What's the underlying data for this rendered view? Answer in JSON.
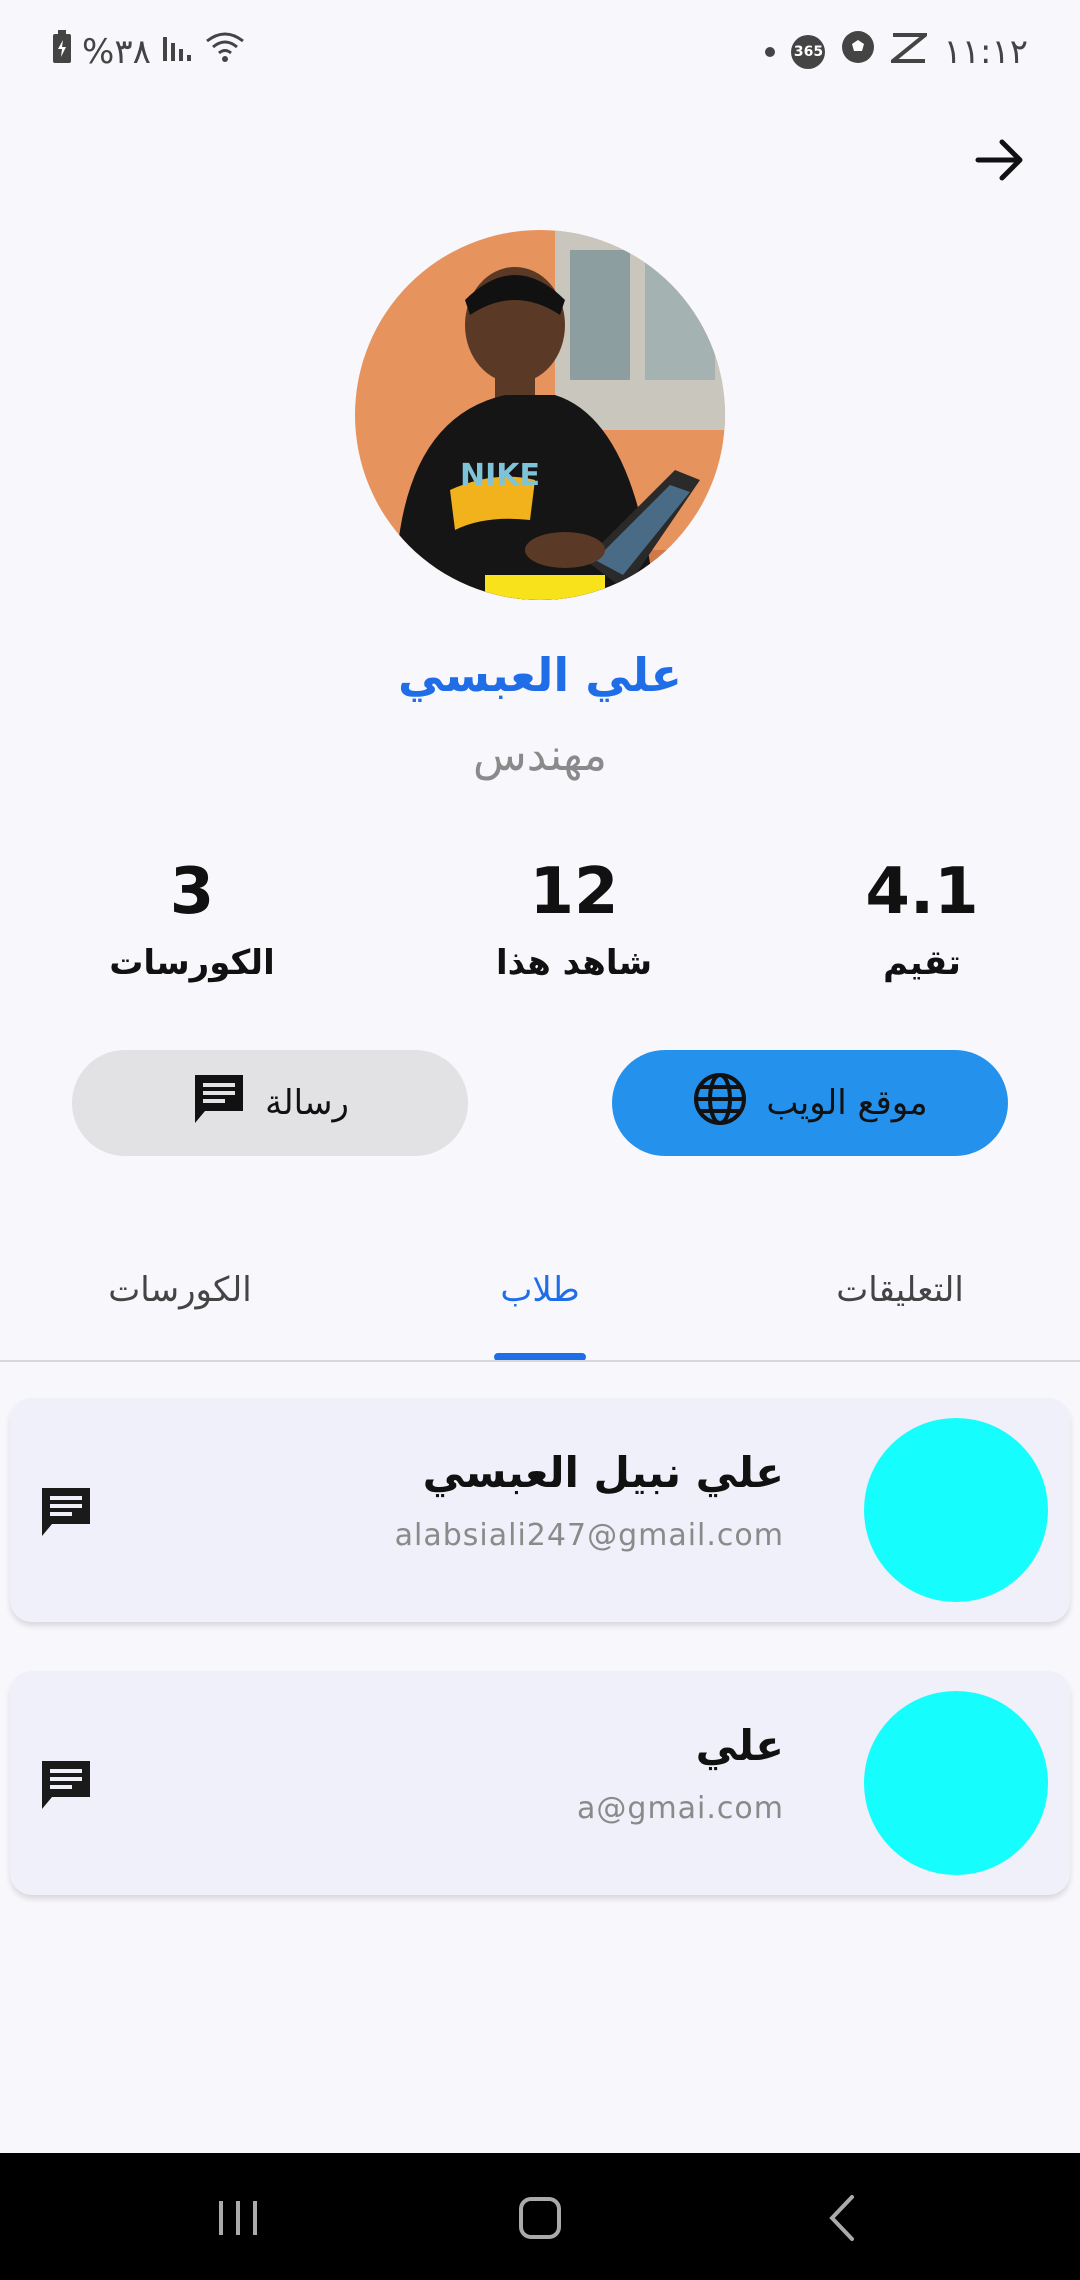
{
  "status_bar": {
    "time": "١١:١٢",
    "battery": "%٣٨",
    "icon_365": "365"
  },
  "profile": {
    "name": "علي العبسي",
    "role": "مهندس"
  },
  "stats": [
    {
      "value": "4.1",
      "label": "تقيم"
    },
    {
      "value": "12",
      "label": "شاهد هذا"
    },
    {
      "value": "3",
      "label": "الكورسات"
    }
  ],
  "actions": {
    "website_label": "موقع الويب",
    "message_label": "رسالة"
  },
  "tabs": [
    {
      "label": "التعليقات"
    },
    {
      "label": "طلاب",
      "active": true
    },
    {
      "label": "الكورسات"
    }
  ],
  "students": [
    {
      "name": "علي نبيل العبسي",
      "email": "alabsiali247@gmail.com"
    },
    {
      "name": "علي",
      "email": "a@gmai.com"
    }
  ],
  "colors": {
    "accent": "#1f6ee8",
    "web_button": "#2492ec",
    "avatar_placeholder": "#15fdfc"
  }
}
